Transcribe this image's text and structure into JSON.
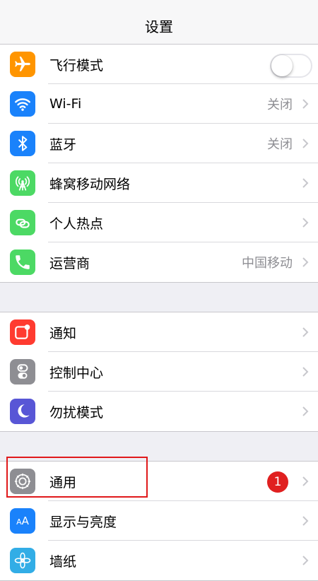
{
  "nav": {
    "title": "设置"
  },
  "colors": {
    "orange": "#ff9500",
    "blue": "#1a82fb",
    "green": "#4cd964",
    "red": "#ff3b30",
    "gray": "#8e8e93",
    "purple": "#5856d6",
    "highlight": "#e0191b"
  },
  "groups": [
    {
      "items": [
        {
          "label": "飞行模式",
          "icon": "airplane-icon",
          "toggle": "off"
        },
        {
          "label": "Wi-Fi",
          "icon": "wifi-icon",
          "value": "关闭"
        },
        {
          "label": "蓝牙",
          "icon": "bluetooth-icon",
          "value": "关闭"
        },
        {
          "label": "蜂窝移动网络",
          "icon": "cellular-icon"
        },
        {
          "label": "个人热点",
          "icon": "hotspot-icon"
        },
        {
          "label": "运营商",
          "icon": "phone-icon",
          "value": "中国移动"
        }
      ]
    },
    {
      "items": [
        {
          "label": "通知",
          "icon": "notification-icon"
        },
        {
          "label": "控制中心",
          "icon": "control-center-icon"
        },
        {
          "label": "勿扰模式",
          "icon": "moon-icon"
        }
      ]
    },
    {
      "items": [
        {
          "label": "通用",
          "icon": "gear-icon",
          "badge": "1"
        },
        {
          "label": "显示与亮度",
          "icon": "display-brightness-icon"
        },
        {
          "label": "墙纸",
          "icon": "wallpaper-icon"
        }
      ]
    }
  ]
}
